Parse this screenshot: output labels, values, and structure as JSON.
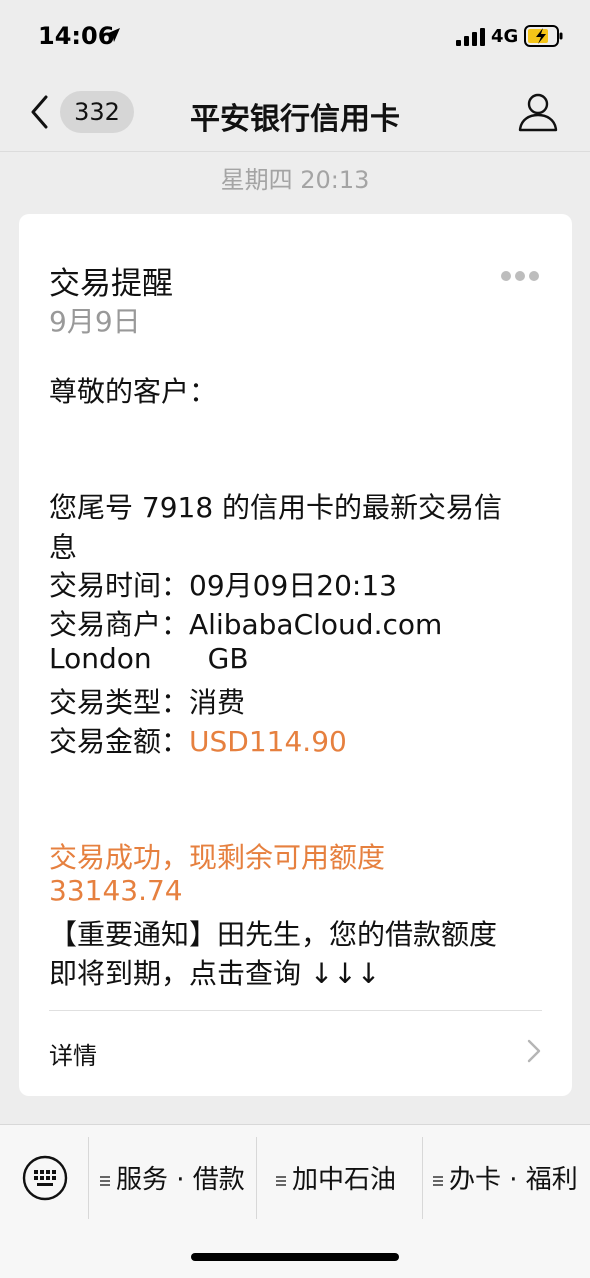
{
  "status_bar": {
    "time": "14:06",
    "network": "4G"
  },
  "nav": {
    "back_badge": "332",
    "title": "平安银行信用卡"
  },
  "timestamp": "星期四 20:13",
  "message": {
    "title": "交易提醒",
    "date": "9月9日",
    "greeting": "尊敬的客户：",
    "intro_line1": "您尾号 7918 的信用卡的最新交易信",
    "intro_line2": "息",
    "time_label": "交易时间：",
    "time_value": "09月09日20:13",
    "merchant_label": "交易商户：",
    "merchant_value": "AlibabaCloud.com",
    "merchant_city": "London",
    "merchant_country": "GB",
    "type_label": "交易类型：",
    "type_value": "消费",
    "amount_label": "交易金额：",
    "amount_value": "USD114.90",
    "success_line": "交易成功，现剩余可用额度",
    "available_credit": "33143.74",
    "notice_line1": "【重要通知】田先生，您的借款额度",
    "notice_line2": "即将到期，点击查询 ↓↓↓",
    "details_label": "详情"
  },
  "menu": {
    "items": [
      "服务 · 借款",
      "加中石油",
      "办卡 · 福利"
    ]
  },
  "colors": {
    "accent_orange": "#e6803f",
    "background": "#ededed",
    "card": "#ffffff"
  }
}
